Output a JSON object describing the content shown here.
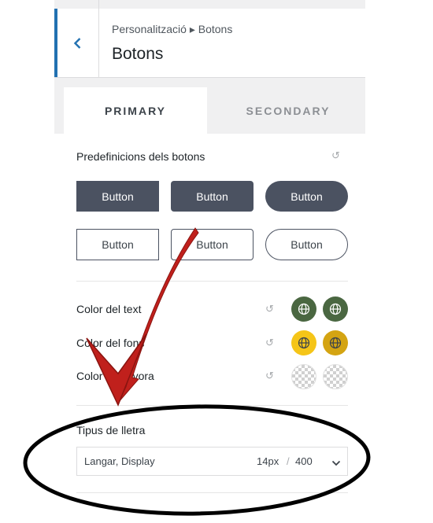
{
  "header": {
    "breadcrumb": "Personalització ▸ Botons",
    "title": "Botons"
  },
  "tabs": [
    {
      "label": "PRIMARY",
      "active": true
    },
    {
      "label": "SECONDARY",
      "active": false
    }
  ],
  "presets": {
    "label": "Predefinicions dels botons",
    "filled_buttons": [
      "Button",
      "Button",
      "Button"
    ],
    "outline_buttons": [
      "Button",
      "Button",
      "Button"
    ]
  },
  "colors": {
    "rows": [
      {
        "label": "Color del text",
        "swatches": [
          "#4a6741",
          "#4a6741"
        ]
      },
      {
        "label": "Color del fons",
        "swatches": [
          "#f5c518",
          "#d4a412"
        ]
      },
      {
        "label": "Color de la vora",
        "swatches": [
          "transparent",
          "transparent"
        ]
      }
    ]
  },
  "typography": {
    "label": "Tipus de lletra",
    "font_name": "Langar, Display",
    "font_size": "14px",
    "separator": "/",
    "font_weight": "400"
  },
  "theme": {
    "accent": "#2271b1",
    "button_dark": "#4b5261",
    "annotation_red": "#c0201c"
  }
}
